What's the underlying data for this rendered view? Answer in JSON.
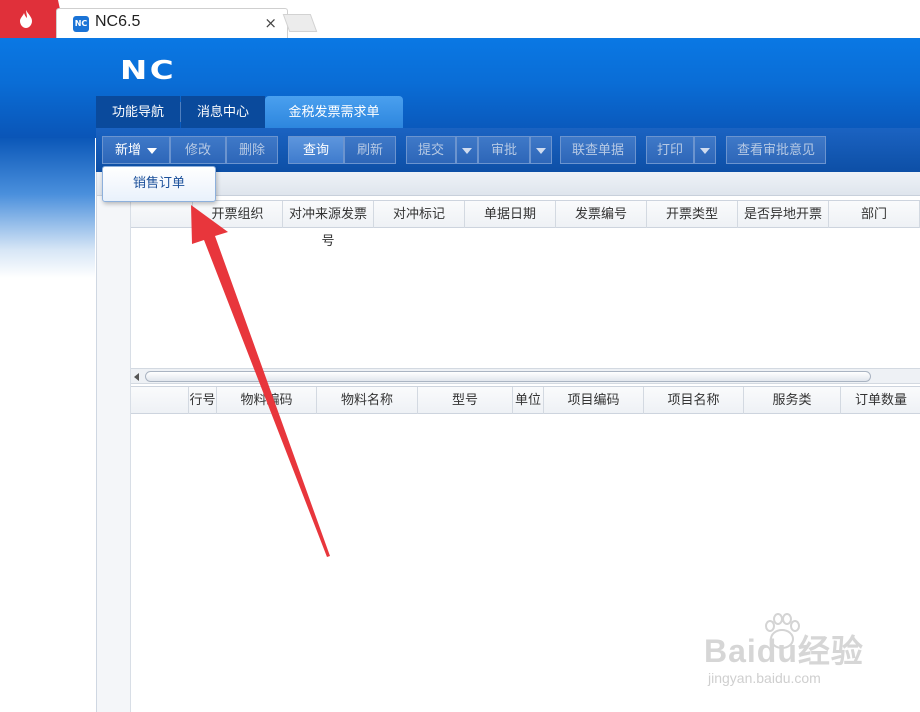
{
  "browser": {
    "tab_title": "NC6.5",
    "favicon_text": "NC",
    "close_glyph": "×",
    "app_icon": "flame-icon"
  },
  "header": {
    "logo": "NC"
  },
  "main_tabs": [
    {
      "label": "功能导航",
      "active": false
    },
    {
      "label": "消息中心",
      "active": false
    },
    {
      "label": "金税发票需求单",
      "active": true
    }
  ],
  "toolbar": {
    "add": "新增",
    "modify": "修改",
    "delete": "删除",
    "query": "查询",
    "refresh": "刷新",
    "submit": "提交",
    "approve": "审批",
    "linked_query": "联查单据",
    "print": "打印",
    "view_approval": "查看审批意见"
  },
  "dropdown": {
    "items": [
      "销售订单"
    ]
  },
  "header_grid": {
    "columns": [
      "开票组织",
      "对冲来源发票号",
      "对冲标记",
      "单据日期",
      "发票编号",
      "开票类型",
      "是否异地开票",
      "部门"
    ]
  },
  "body_grid": {
    "columns": [
      "行号",
      "物料编码",
      "物料名称",
      "型号",
      "单位",
      "项目编码",
      "项目名称",
      "服务类",
      "订单数量"
    ]
  },
  "watermark": {
    "brand": "Baidu经验",
    "url": "jingyan.baidu.com"
  },
  "colors": {
    "header_blue": "#0a6dd6",
    "toolbar_blue": "#1b63c2",
    "active_tab": "#3f92e6",
    "annotation_red": "#e8363c"
  }
}
